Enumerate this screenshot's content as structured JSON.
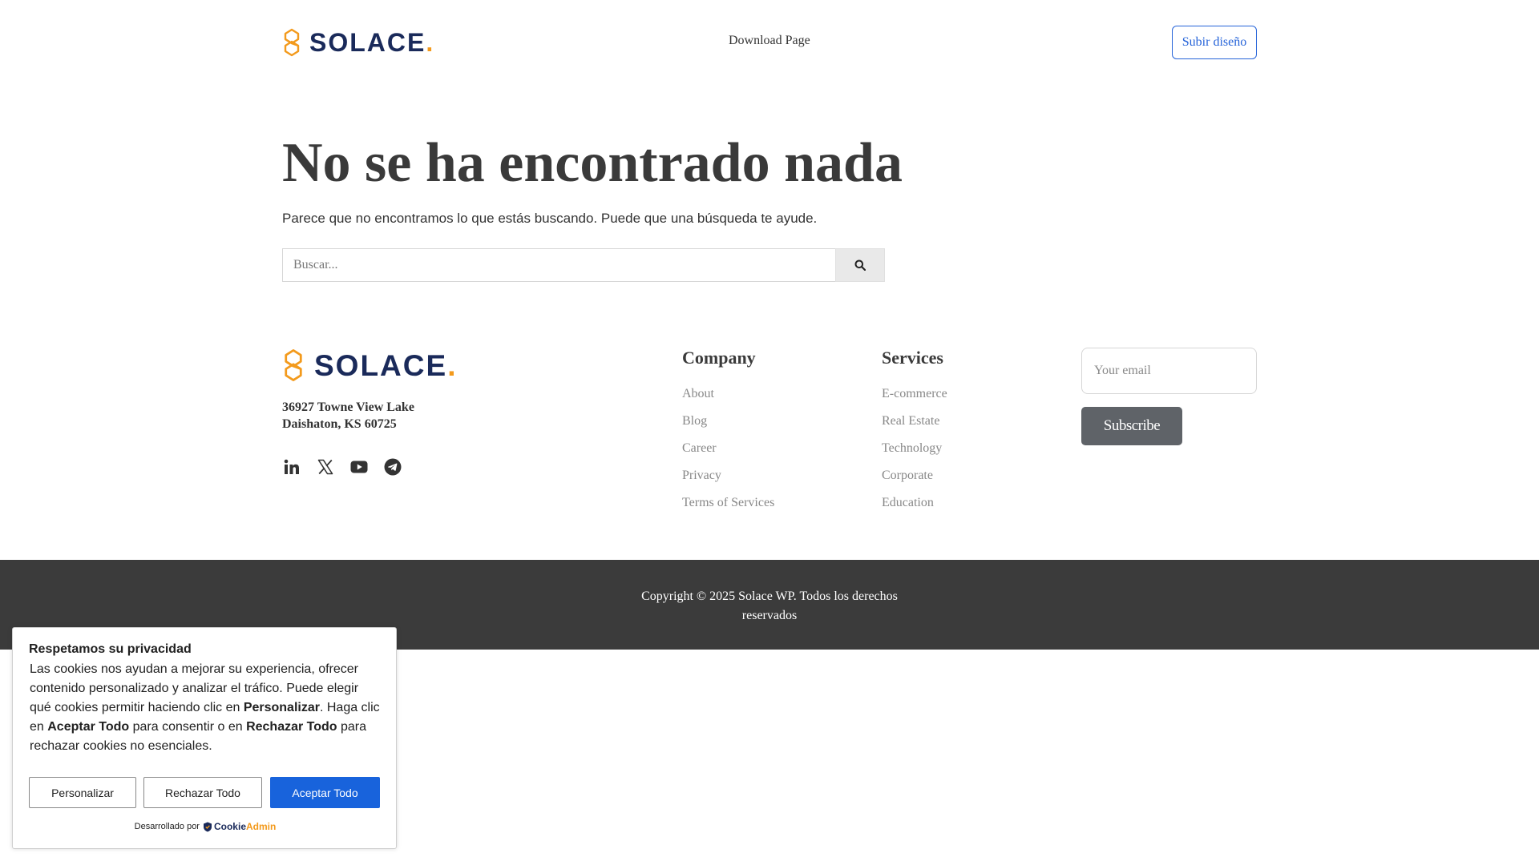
{
  "header": {
    "logo_text": "SOLACE",
    "logo_dot": ".",
    "nav_link": "Download Page",
    "upload_button": "Subir diseño"
  },
  "main": {
    "title": "No se ha encontrado nada",
    "subtitle": "Parece que no encontramos lo que estás buscando. Puede que una búsqueda te ayude.",
    "search_placeholder": "Buscar..."
  },
  "footer": {
    "logo_text": "SOLACE",
    "logo_dot": ".",
    "address_line1": "36927 Towne View Lake",
    "address_line2": "Daishaton, KS 60725",
    "socials": [
      "linkedin-icon",
      "x-twitter-icon",
      "youtube-icon",
      "telegram-icon"
    ],
    "company": {
      "heading": "Company",
      "items": [
        "About",
        "Blog",
        "Career",
        "Privacy",
        "Terms of Services"
      ]
    },
    "services": {
      "heading": "Services",
      "items": [
        "E-commerce",
        "Real Estate",
        "Technology",
        "Corporate",
        "Education"
      ]
    },
    "email_placeholder": "Your email",
    "subscribe_button": "Subscribe",
    "copyright": "Copyright © 2025 Solace WP. Todos los derechos reservados"
  },
  "cookie": {
    "title": "Respetamos su privacidad",
    "text_1": "Las cookies nos ayudan a mejorar su experiencia, ofrecer contenido personalizado y analizar el tráfico. Puede elegir qué cookies permitir haciendo clic en ",
    "text_bold_1": "Personalizar",
    "text_2": ". Haga clic en ",
    "text_bold_2": "Aceptar Todo",
    "text_3": " para consentir o en ",
    "text_bold_3": "Rechazar Todo",
    "text_4": " para rechazar cookies no esenciales.",
    "customize_button": "Personalizar",
    "reject_button": "Rechazar Todo",
    "accept_button": "Aceptar Todo",
    "powered_by": "Desarrollado por",
    "brand_part1": "Cookie",
    "brand_part2": "Admin"
  },
  "colors": {
    "brand_navy": "#1a2a5a",
    "brand_orange": "#f39a1c",
    "accent_blue": "#2563d9",
    "cookie_accept_blue": "#1863dc",
    "footer_bar": "#3b3b3b"
  }
}
